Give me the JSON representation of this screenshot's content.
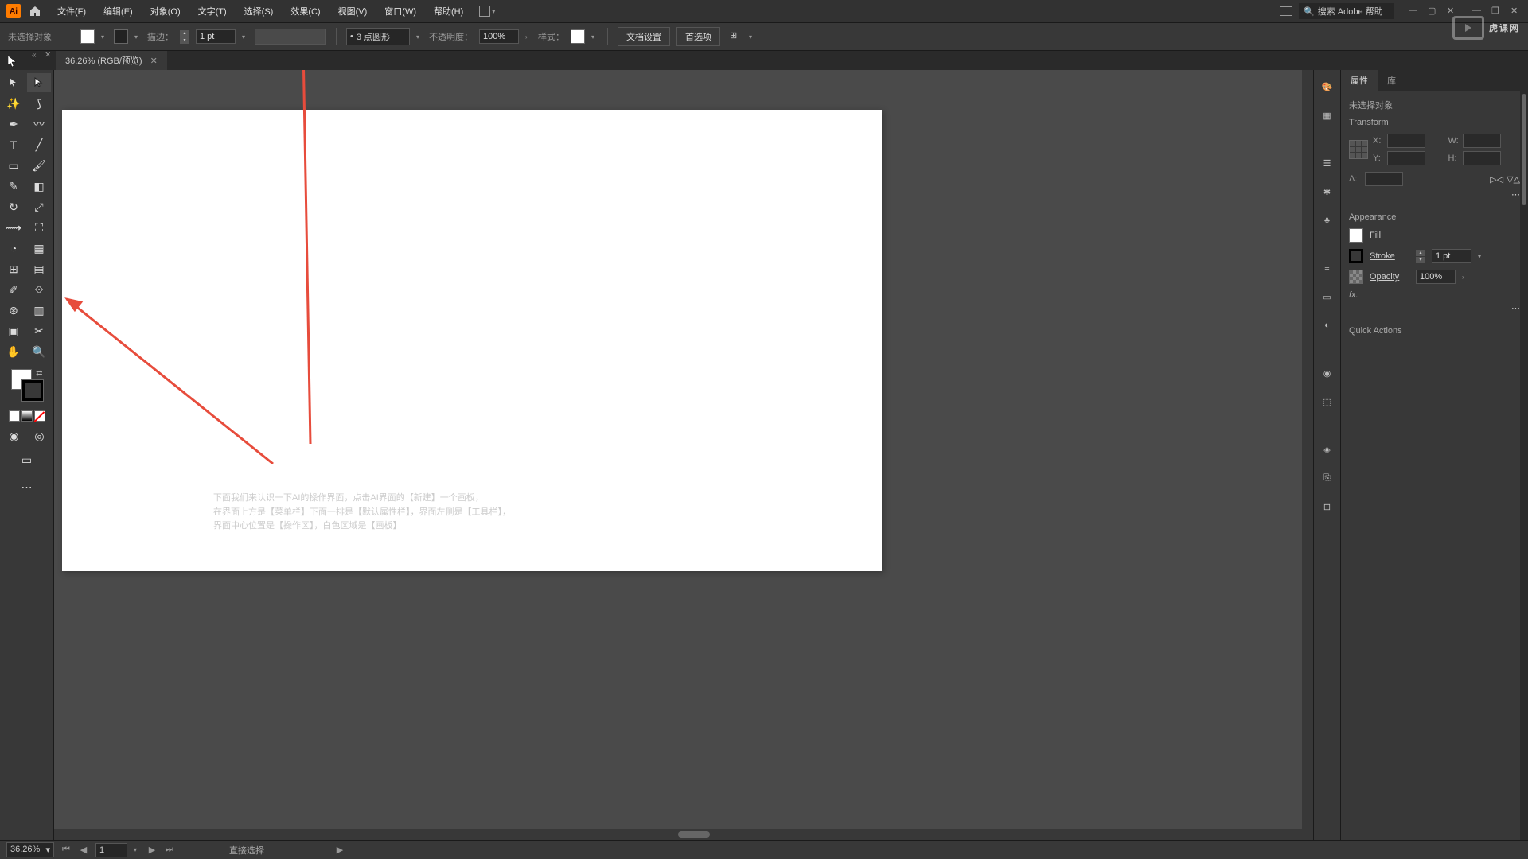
{
  "menubar": {
    "app": "Ai",
    "items": [
      "文件(F)",
      "编辑(E)",
      "对象(O)",
      "文字(T)",
      "选择(S)",
      "效果(C)",
      "视图(V)",
      "窗口(W)",
      "帮助(H)"
    ],
    "search_placeholder": "搜索 Adobe 帮助"
  },
  "controlbar": {
    "no_selection": "未选择对象",
    "stroke_label": "描边：",
    "stroke_val": "1 pt",
    "brush_val": "3 点圆形",
    "opacity_label": "不透明度：",
    "opacity_val": "100%",
    "style_label": "样式：",
    "doc_setup": "文档设置",
    "prefs": "首选项"
  },
  "tab": {
    "title": "36.26% (RGB/预览)"
  },
  "annotation": {
    "l1": "下面我们来认识一下AI的操作界面，点击AI界面的【新建】一个画板，",
    "l2": "在界面上方是【菜单栏】下面一排是【默认属性栏】，界面左侧是【工具栏】，",
    "l3": "界面中心位置是【操作区】，白色区域是【画板】"
  },
  "props": {
    "tab1": "属性",
    "tab2": "库",
    "no_sel": "未选择对象",
    "transform": "Transform",
    "x": "X:",
    "y": "Y:",
    "w": "W:",
    "h": "H:",
    "angle": "Δ:",
    "appearance": "Appearance",
    "fill": "Fill",
    "stroke": "Stroke",
    "stroke_val": "1 pt",
    "opacity": "Opacity",
    "opacity_val": "100%",
    "fx": "fx.",
    "quick": "Quick Actions"
  },
  "status": {
    "zoom": "36.26%",
    "artboard": "1",
    "tool": "直接选择"
  },
  "watermark": "虎课网"
}
